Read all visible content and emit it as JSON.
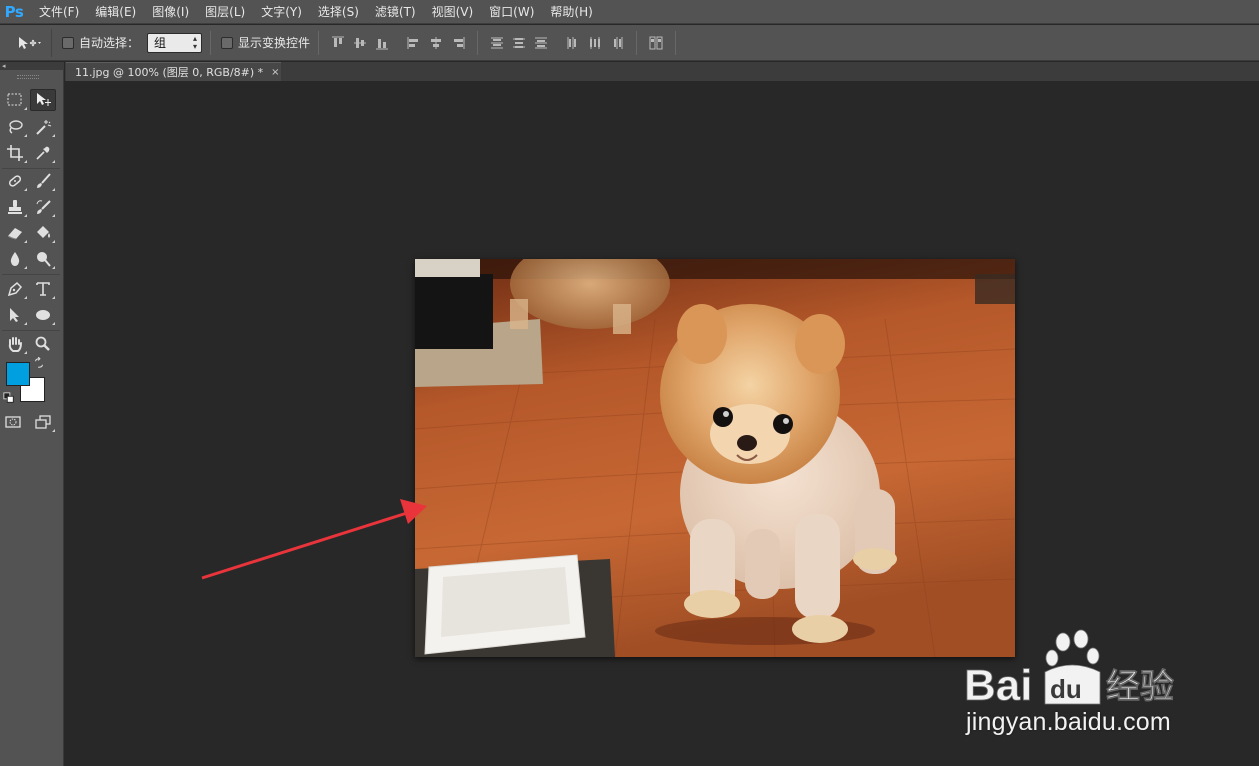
{
  "app": {
    "logo": "Ps"
  },
  "menu": [
    "文件(F)",
    "编辑(E)",
    "图像(I)",
    "图层(L)",
    "文字(Y)",
    "选择(S)",
    "滤镜(T)",
    "视图(V)",
    "窗口(W)",
    "帮助(H)"
  ],
  "options_bar": {
    "auto_select_label": "自动选择：",
    "auto_select_checked": false,
    "auto_select_value": "组",
    "show_transform_label": "显示变换控件",
    "show_transform_checked": false
  },
  "document": {
    "tab_title": "11.jpg @ 100% (图层 0, RGB/8#) *",
    "close_glyph": "×"
  },
  "colors": {
    "foreground": "#00a0e0",
    "background": "#ffffff",
    "accent_arrow": "#e8343a"
  },
  "tools": [
    "marquee-icon",
    "move-icon",
    "lasso-icon",
    "magic-wand-icon",
    "crop-icon",
    "eyedropper-icon",
    "healing-brush-icon",
    "brush-icon",
    "clone-stamp-icon",
    "history-brush-icon",
    "eraser-icon",
    "paint-bucket-icon",
    "blur-icon",
    "dodge-icon",
    "pen-icon",
    "type-icon",
    "path-selection-icon",
    "ellipse-icon",
    "hand-icon",
    "zoom-icon",
    "quick-mask-icon",
    "screen-mode-icon"
  ],
  "watermark": {
    "brand_left": "Bai",
    "brand_right": "du",
    "brand_cn": "经验",
    "url": "jingyan.baidu.com"
  }
}
